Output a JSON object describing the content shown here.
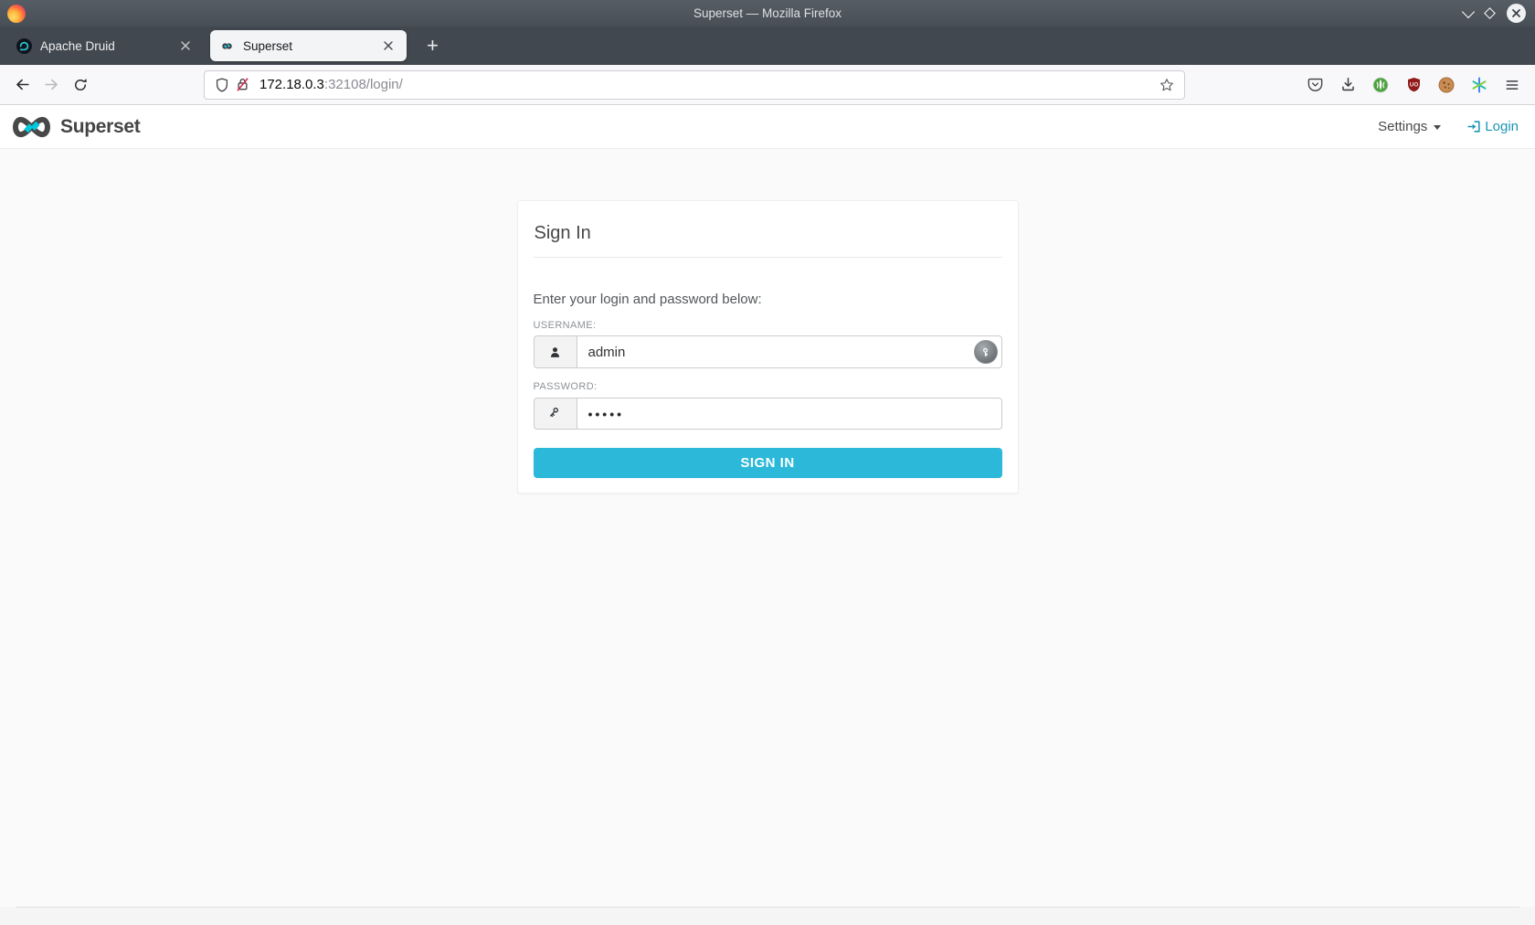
{
  "window": {
    "title": "Superset — Mozilla Firefox"
  },
  "browser": {
    "tabs": [
      {
        "label": "Apache Druid",
        "active": false
      },
      {
        "label": "Superset",
        "active": true
      }
    ],
    "url": {
      "host": "172.18.0.3",
      "rest": ":32108/login/"
    },
    "ublock_badge": "UO",
    "new_tab_glyph": "+"
  },
  "navbar": {
    "brand": "Superset",
    "settings_label": "Settings",
    "login_label": "Login"
  },
  "login_card": {
    "title": "Sign In",
    "prompt": "Enter your login and password below:",
    "username_label": "USERNAME:",
    "username_value": "admin",
    "password_label": "PASSWORD:",
    "password_value": "•••••",
    "submit_label": "SIGN IN"
  },
  "icons": {
    "ublock": "red shield",
    "cookie": "cookie",
    "green_extension": "green circle",
    "asterisk_extension": "multicolor asterisk",
    "password_manager": "key in gray circle"
  },
  "colors": {
    "titlebar": "#4c535b",
    "tabbar": "#42484f",
    "accent_button": "#2bb8d9",
    "login_link": "#1b96b4",
    "insecure_slash": "#e22850"
  }
}
